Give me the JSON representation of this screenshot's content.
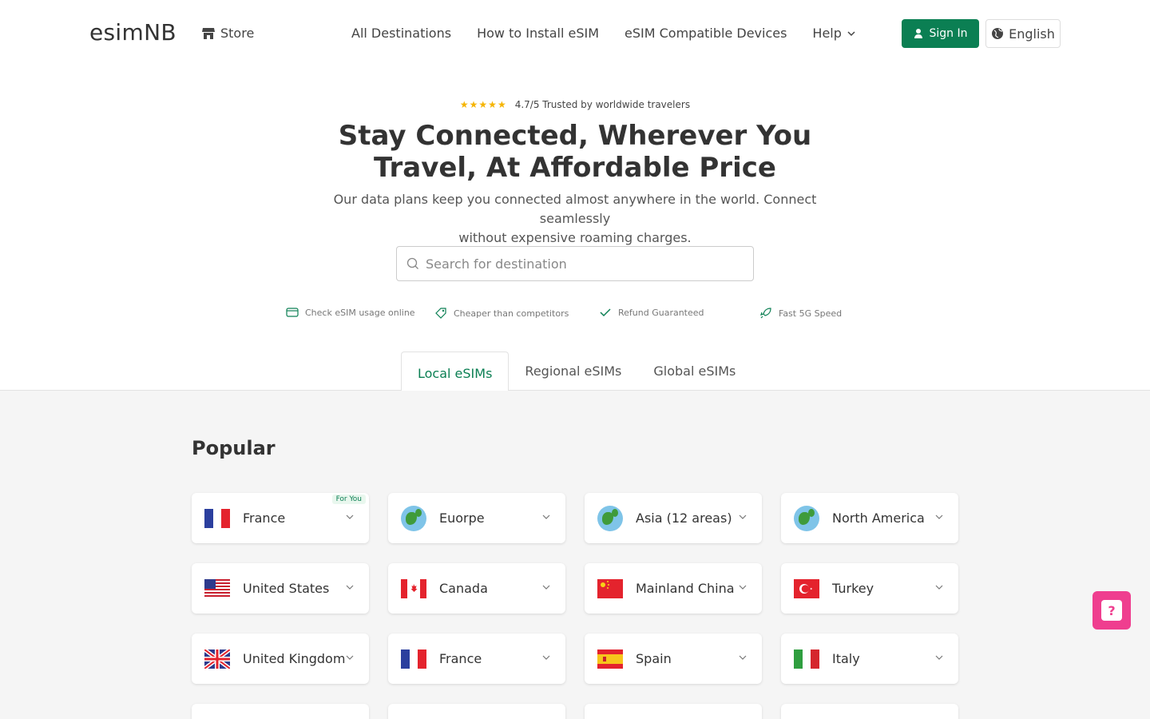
{
  "header": {
    "logo": "esimNB",
    "store_label": "Store",
    "nav": [
      "All Destinations",
      "How to Install eSIM",
      "eSIM Compatible Devices",
      "Help"
    ],
    "signin_label": "Sign In",
    "language_label": "English"
  },
  "hero": {
    "stars": "★★★★★",
    "rating_text": "4.7/5 Trusted by worldwide travelers",
    "title_line1": "Stay Connected, Wherever You",
    "title_line2": "Travel, At Affordable Price",
    "subtitle_line1": "Our data plans keep you connected almost anywhere in the world. Connect seamlessly",
    "subtitle_line2": "without expensive roaming charges.",
    "search_placeholder": "Search for destination"
  },
  "features": [
    "Check eSIM usage online",
    "Cheaper than competitors",
    "Refund Guaranteed",
    "Fast 5G Speed"
  ],
  "tabs": [
    "Local eSIMs",
    "Regional eSIMs",
    "Global eSIMs"
  ],
  "active_tab": "Local eSIMs",
  "section_title": "Popular",
  "badge_label": "For You",
  "cards": [
    {
      "name": "France",
      "icon": "flag-france"
    },
    {
      "name": "Euorpe",
      "icon": "globe"
    },
    {
      "name": "Asia (12 areas)",
      "icon": "globe"
    },
    {
      "name": "North America",
      "icon": "globe"
    },
    {
      "name": "United States",
      "icon": "flag-us"
    },
    {
      "name": "Canada",
      "icon": "flag-canada"
    },
    {
      "name": "Mainland China",
      "icon": "flag-china"
    },
    {
      "name": "Turkey",
      "icon": "flag-turkey"
    },
    {
      "name": "United Kingdom",
      "icon": "flag-uk"
    },
    {
      "name": "France",
      "icon": "flag-france"
    },
    {
      "name": "Spain",
      "icon": "flag-spain"
    },
    {
      "name": "Italy",
      "icon": "flag-italy"
    }
  ],
  "help_button_glyph": "?",
  "colors": {
    "accent": "#0b7f53",
    "star": "#f5b400",
    "help": "#ef3e8f"
  }
}
